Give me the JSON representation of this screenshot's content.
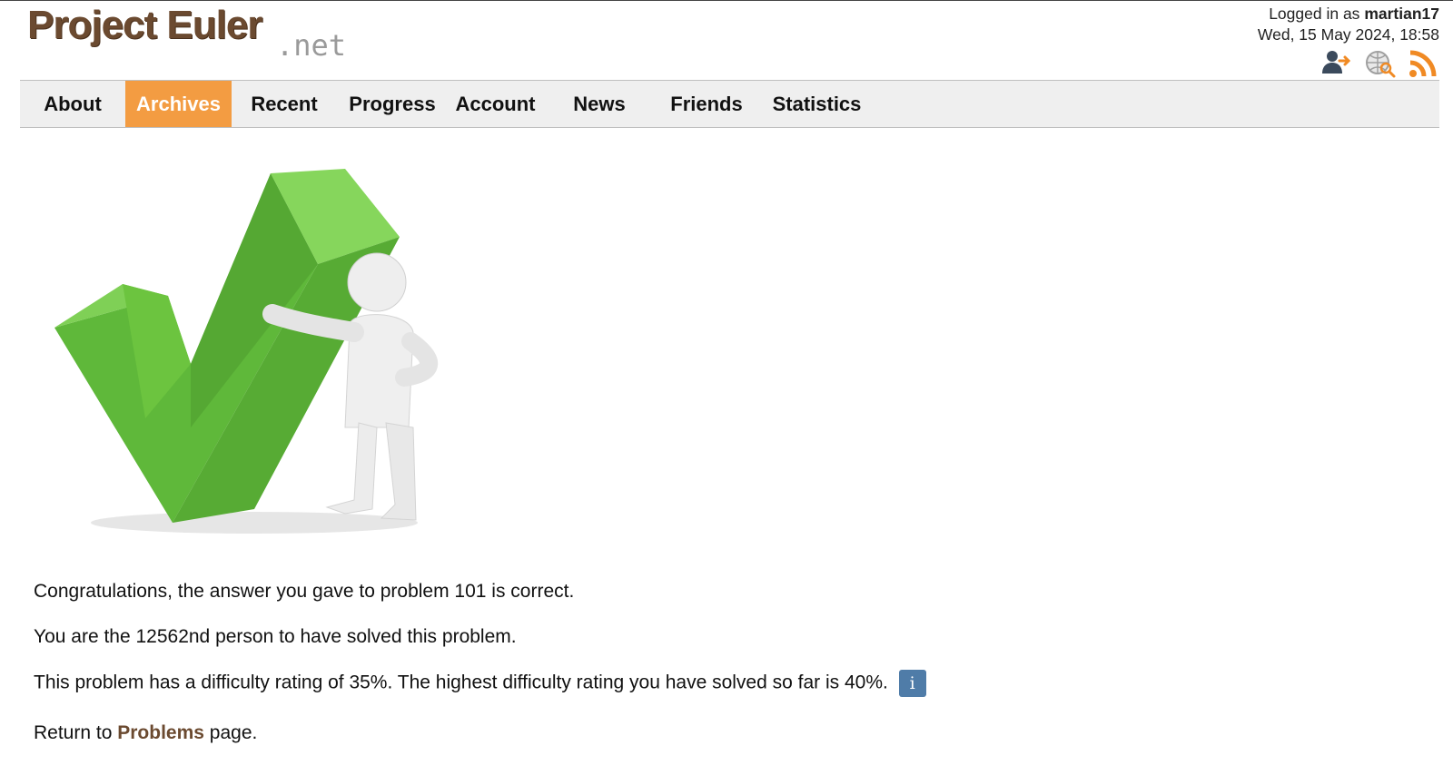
{
  "site": {
    "logo_main": "Project Euler",
    "logo_suffix": ".net"
  },
  "user": {
    "logged_in_prefix": "Logged in as",
    "username": "martian17",
    "datetime": "Wed, 15 May 2024, 18:58"
  },
  "top_icons": [
    "logout-icon",
    "search-icon",
    "rss-icon"
  ],
  "nav": {
    "items": [
      {
        "label": "About"
      },
      {
        "label": "Archives",
        "active": true
      },
      {
        "label": "Recent"
      },
      {
        "label": "Progress"
      },
      {
        "label": "Account"
      },
      {
        "label": "News"
      },
      {
        "label": "Friends"
      },
      {
        "label": "Statistics"
      }
    ],
    "active_color": "#f39c42"
  },
  "result": {
    "congrats": "Congratulations, the answer you gave to problem 101 is correct.",
    "rank": "You are the 12562nd person to have solved this problem.",
    "difficulty": "This problem has a difficulty rating of 35%. The highest difficulty rating you have solved so far is 40%.",
    "info_glyph": "i",
    "return_prefix": "Return to",
    "return_link": "Problems",
    "return_suffix": "page."
  },
  "colors": {
    "brand_brown": "#6b4a30",
    "check_green": "#5fb83a",
    "info_blue": "#4f7ca8"
  }
}
